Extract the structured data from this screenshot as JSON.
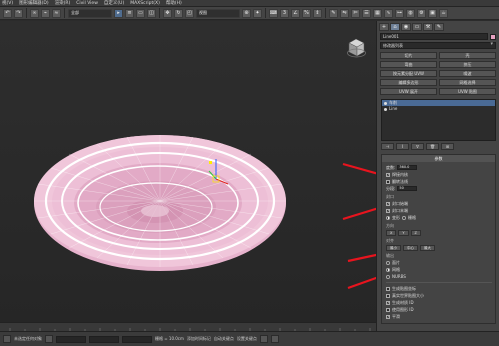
{
  "menubar": {
    "items": [
      "视(V)",
      "图形编辑器(D)",
      "渲染(R)",
      "Civil View",
      "自定义(U)",
      "MAXScript(X)",
      "帮助(H)"
    ]
  },
  "toolbar": {
    "selection_filter": "全部",
    "view_label": "视图"
  },
  "command_panel": {
    "tabs": [
      "+",
      "⌂",
      "◉",
      "▭",
      "⚒",
      "✎"
    ],
    "object_name": "Line001",
    "object_color": "#e7a2c2",
    "modifier_list": "修改器列表",
    "buttons": [
      "切片",
      "壳",
      "弯曲",
      "挤压",
      "按元素分配 UVW",
      "噪波",
      "编辑多边形",
      "网格选择",
      "UVW 展开",
      "UVW 贴图"
    ],
    "stack_items": [
      {
        "label": "车削",
        "selected": true
      },
      {
        "label": "Line",
        "selected": false
      }
    ],
    "stack_tools": [
      "⊣",
      "Ι",
      "∀",
      "🗑",
      "⊞"
    ]
  },
  "parameters": {
    "header": "参数",
    "degrees_label": "度数:",
    "degrees_value": "360.0",
    "weld_core_label": "焊接内核",
    "flip_normals_label": "翻转法线",
    "segments_label": "分段:",
    "segments_value": "50",
    "capping_label": "封口",
    "cap_start_label": "封口始端",
    "cap_end_label": "封口末端",
    "morph_label": "变形",
    "grid_label": "栅格",
    "direction_label": "方向",
    "axes": [
      "X",
      "Y",
      "Z"
    ],
    "align_label": "对齐",
    "align_buttons": [
      "最小",
      "中心",
      "最大"
    ],
    "output_label": "输出",
    "output_options": [
      "面片",
      "网格",
      "NURBS"
    ],
    "gen_mapping_label": "生成贴图坐标",
    "real_world_label": "真实世界贴图大小",
    "gen_material_label": "生成材质 ID",
    "use_shape_ids_label": "使用图形 ID",
    "smooth_label": "平滑"
  },
  "statusbar": {
    "mode_label": "未选定任何对象",
    "grid_label": "栅格 = 10.0cm",
    "add_time_tag": "添加时间标记",
    "auto_key": "自动关键点",
    "set_key": "设置关键点"
  },
  "viewport": {
    "label": "透视"
  }
}
